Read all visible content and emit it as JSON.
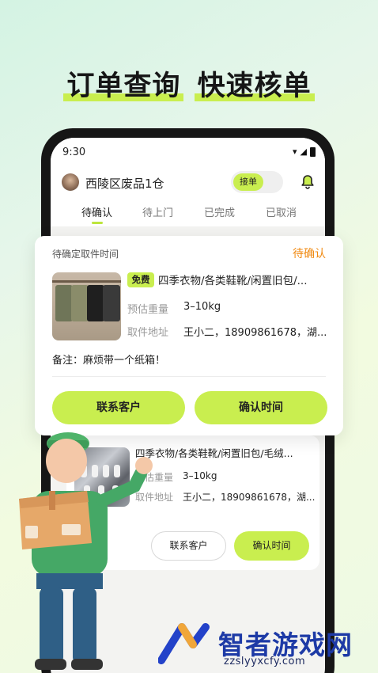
{
  "headline": {
    "part1": "订单查询",
    "part2": "快速核单"
  },
  "status_bar": {
    "time": "9:30"
  },
  "header": {
    "store_name": "西陵区废品1仓",
    "toggle_label": "接单"
  },
  "tabs": [
    {
      "label": "待确认"
    },
    {
      "label": "待上门"
    },
    {
      "label": "已完成"
    },
    {
      "label": "已取消"
    }
  ],
  "order_card": {
    "pickup_time_label": "待确定取件时间",
    "status": "待确认",
    "free_tag": "免费",
    "title": "四季衣物/各类鞋靴/闲置旧包/...",
    "weight_label": "预估重量",
    "weight_value": "3–10kg",
    "address_label": "取件地址",
    "address_value": "王小二，18909861678，湖...",
    "note": "备注：麻烦带一个纸箱！",
    "contact_button": "联系客户",
    "confirm_button": "确认时间"
  },
  "order_card_2": {
    "title": "四季衣物/各类鞋靴/闲置旧包/毛绒...",
    "weight_label": "预估重量",
    "weight_value": "3–10kg",
    "address_label": "取件地址",
    "address_value": "王小二，18909861678，湖...",
    "contact_button": "联系客户",
    "confirm_button": "确认时间"
  },
  "watermark": {
    "text": "智者游戏网",
    "url": "zzslyyxcfy.com"
  },
  "colors": {
    "accent": "#c9ee4f",
    "status_orange": "#f08a12",
    "watermark_blue": "#1d3aa6"
  }
}
